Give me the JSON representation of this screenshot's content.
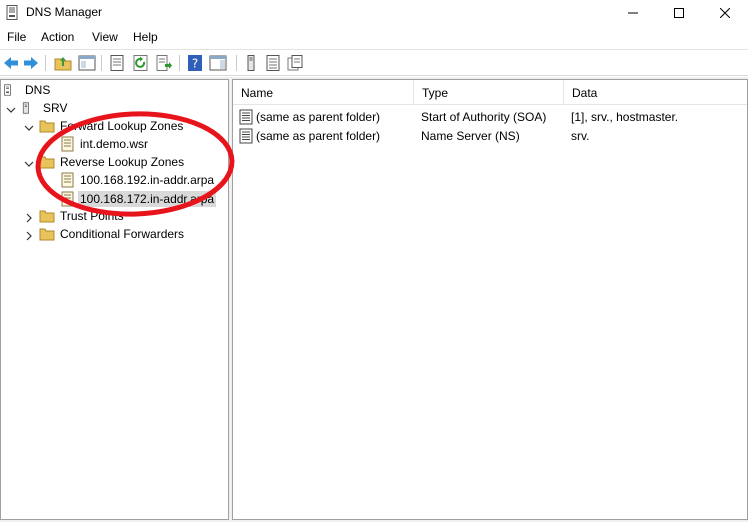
{
  "window": {
    "title": "DNS Manager"
  },
  "menu": {
    "items": [
      "File",
      "Action",
      "View",
      "Help"
    ]
  },
  "tree": {
    "root": "DNS",
    "server": "SRV",
    "forward_zones": "Forward Lookup Zones",
    "forward_child": "int.demo.wsr",
    "reverse_zones": "Reverse Lookup Zones",
    "reverse_child_1": "100.168.192.in-addr.arpa",
    "reverse_child_2": "100.168.172.in-addr.arpa",
    "trust_points": "Trust Points",
    "conditional_forwarders": "Conditional Forwarders"
  },
  "list": {
    "columns": [
      "Name",
      "Type",
      "Data"
    ],
    "rows": [
      {
        "name": "(same as parent folder)",
        "type": "Start of Authority (SOA)",
        "data": "[1], srv., hostmaster."
      },
      {
        "name": "(same as parent folder)",
        "type": "Name Server (NS)",
        "data": "srv."
      }
    ]
  },
  "colors": {
    "annotation": "#e8141c",
    "selection": "#d9d9d9",
    "folder": "#e8c35b"
  }
}
